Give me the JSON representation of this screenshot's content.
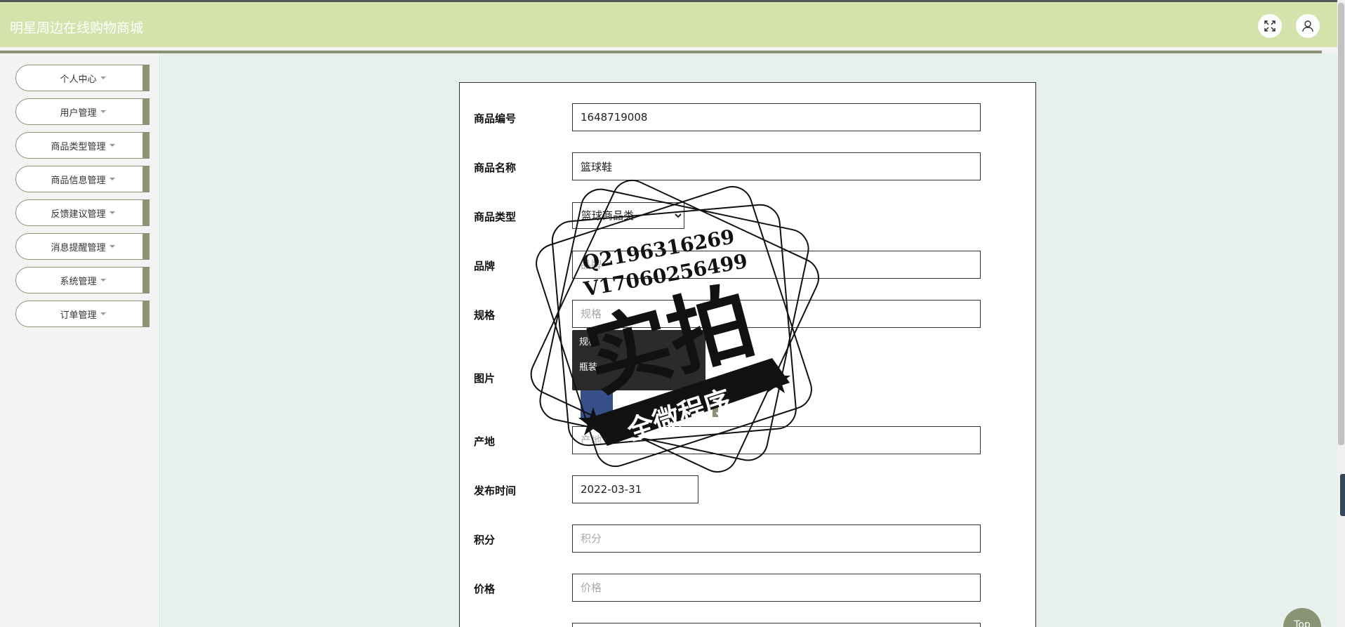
{
  "app": {
    "title": "明星周边在线购物商城"
  },
  "header": {
    "fullscreen_icon": "expand-icon",
    "user_icon": "user-icon"
  },
  "sidebar": {
    "items": [
      {
        "label": "个人中心"
      },
      {
        "label": "用户管理"
      },
      {
        "label": "商品类型管理"
      },
      {
        "label": "商品信息管理"
      },
      {
        "label": "反馈建议管理"
      },
      {
        "label": "消息提醒管理"
      },
      {
        "label": "系统管理"
      },
      {
        "label": "订单管理"
      }
    ]
  },
  "form": {
    "product_code": {
      "label": "商品编号",
      "value": "1648719008"
    },
    "product_name": {
      "label": "商品名称",
      "value": "篮球鞋"
    },
    "product_type": {
      "label": "商品类型",
      "value": "篮球商品类"
    },
    "brand": {
      "label": "品牌",
      "placeholder": "品牌"
    },
    "spec": {
      "label": "规格",
      "placeholder": "规格"
    },
    "image": {
      "label": "图片"
    },
    "origin": {
      "label": "产地",
      "placeholder": "产地"
    },
    "publish_time": {
      "label": "发布时间",
      "value": "2022-03-31"
    },
    "points": {
      "label": "积分",
      "placeholder": "积分"
    },
    "price": {
      "label": "价格",
      "placeholder": "价格"
    }
  },
  "spec_dropdown": {
    "options": [
      "规格",
      "瓶装"
    ]
  },
  "watermark": {
    "line1": "Q2196316269",
    "line2": "V17060256499",
    "main": "实拍",
    "banner": "全微程序"
  },
  "top_button": {
    "label": "Top"
  },
  "colors": {
    "header_bg": "#d4e2ab",
    "accent": "#8b9375",
    "main_bg": "#e7f1ec"
  }
}
